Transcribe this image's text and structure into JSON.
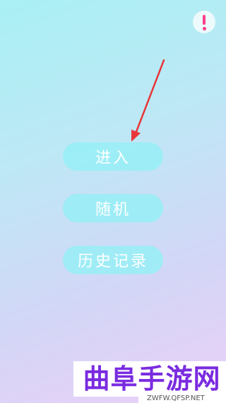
{
  "colors": {
    "background_top": "#a9f0f4",
    "background_bottom": "#ead0f7",
    "button_fill": "#96eef6",
    "button_text": "#ffffff",
    "info_accent": "#ff3d8a",
    "arrow": "#e8363a",
    "watermark_text": "#7a2be0"
  },
  "header": {
    "info_icon": "exclamation-icon"
  },
  "menu": {
    "enter_label": "进入",
    "random_label": "随机",
    "history_label": "历史记录"
  },
  "watermark": {
    "title": "曲阜手游网",
    "url": "ZWFW.QFSP.NET"
  }
}
